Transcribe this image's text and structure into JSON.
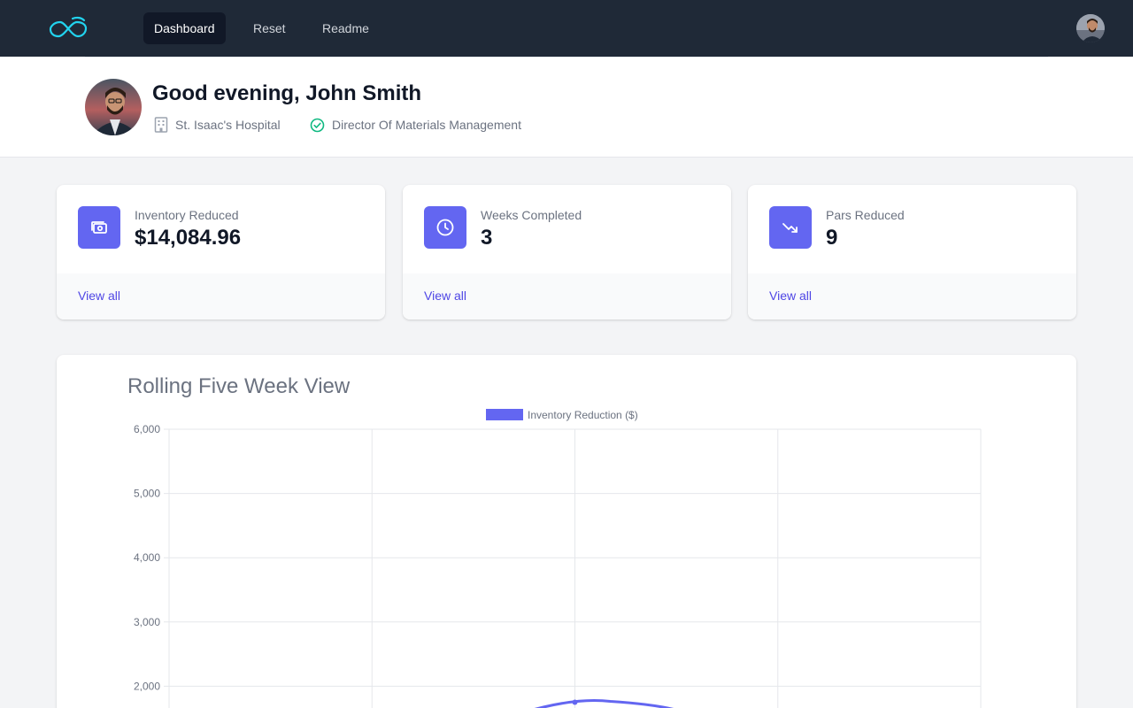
{
  "nav": {
    "logo": "infinity-logo",
    "items": [
      {
        "label": "Dashboard",
        "active": true
      },
      {
        "label": "Reset",
        "active": false
      },
      {
        "label": "Readme",
        "active": false
      }
    ]
  },
  "header": {
    "greeting": "Good evening, John Smith",
    "organization": "St. Isaac's Hospital",
    "role": "Director Of Materials Management"
  },
  "stats": [
    {
      "icon": "cash-icon",
      "label": "Inventory Reduced",
      "value": "$14,084.96",
      "link": "View all"
    },
    {
      "icon": "clock-icon",
      "label": "Weeks Completed",
      "value": "3",
      "link": "View all"
    },
    {
      "icon": "trending-down-icon",
      "label": "Pars Reduced",
      "value": "9",
      "link": "View all"
    }
  ],
  "colors": {
    "nav_bg": "#1f2937",
    "accent": "#6366f1",
    "link": "#4f46e5",
    "check": "#10b981",
    "logo": "#22d3ee"
  },
  "chart": {
    "title": "Rolling Five Week View"
  },
  "chart_data": {
    "type": "line",
    "title": "Rolling Five Week View",
    "series": [
      {
        "name": "Inventory Reduction ($)",
        "values": [
          null,
          null,
          1750,
          null,
          null
        ]
      }
    ],
    "x_categories": [
      "",
      "",
      "",
      "",
      ""
    ],
    "ylim": [
      0,
      6000
    ],
    "yticks": [
      "6,000",
      "5,000",
      "4,000",
      "3,000",
      "2,000"
    ],
    "grid": true,
    "legend": "top-center",
    "line_color": "#6366f1"
  }
}
